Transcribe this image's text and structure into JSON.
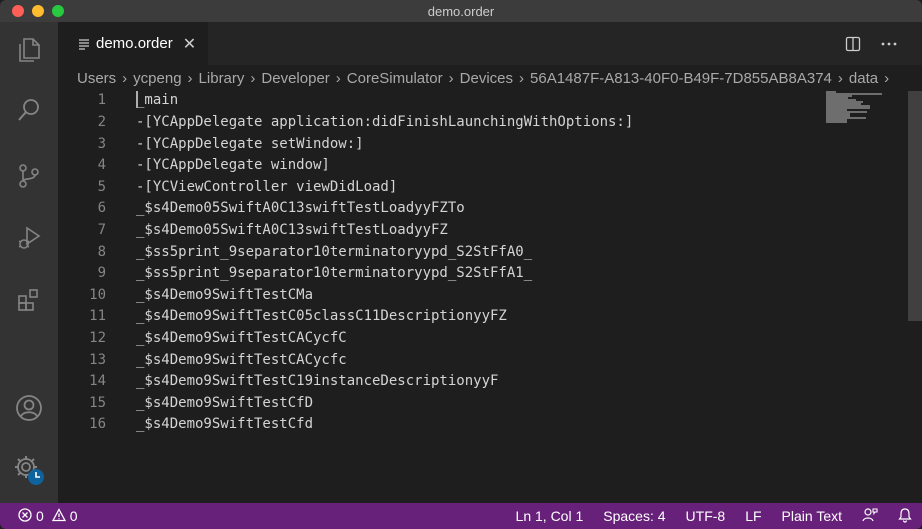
{
  "window": {
    "title": "demo.order"
  },
  "tab": {
    "label": "demo.order",
    "close": "✕"
  },
  "breadcrumb": [
    "Users",
    "ycpeng",
    "Library",
    "Developer",
    "CoreSimulator",
    "Devices",
    "56A1487F-A813-40F0-B49F-7D855AB8A374",
    "data"
  ],
  "editor": {
    "lines": [
      {
        "n": "1",
        "text": "_main"
      },
      {
        "n": "2",
        "text": "-[YCAppDelegate application:didFinishLaunchingWithOptions:]"
      },
      {
        "n": "3",
        "text": "-[YCAppDelegate setWindow:]"
      },
      {
        "n": "4",
        "text": "-[YCAppDelegate window]"
      },
      {
        "n": "5",
        "text": "-[YCViewController viewDidLoad]"
      },
      {
        "n": "6",
        "text": "_$s4Demo05SwiftA0C13swiftTestLoadyyFZTo"
      },
      {
        "n": "7",
        "text": "_$s4Demo05SwiftA0C13swiftTestLoadyyFZ"
      },
      {
        "n": "8",
        "text": "_$ss5print_9separator10terminatoryypd_S2StFfA0_"
      },
      {
        "n": "9",
        "text": "_$ss5print_9separator10terminatoryypd_S2StFfA1_"
      },
      {
        "n": "10",
        "text": "_$s4Demo9SwiftTestCMa"
      },
      {
        "n": "11",
        "text": "_$s4Demo9SwiftTestC05classC11DescriptionyyFZ"
      },
      {
        "n": "12",
        "text": "_$s4Demo9SwiftTestCACycfC"
      },
      {
        "n": "13",
        "text": "_$s4Demo9SwiftTestCACycfc"
      },
      {
        "n": "14",
        "text": "_$s4Demo9SwiftTestC19instanceDescriptionyyF"
      },
      {
        "n": "15",
        "text": "_$s4Demo9SwiftTestCfD"
      },
      {
        "n": "16",
        "text": "_$s4Demo9SwiftTestCfd"
      }
    ]
  },
  "status": {
    "errors": "0",
    "warnings": "0",
    "position": "Ln 1, Col 1",
    "spaces": "Spaces: 4",
    "encoding": "UTF-8",
    "eol": "LF",
    "language": "Plain Text"
  },
  "colors": {
    "statusbar": "#68217a",
    "activitybar": "#333333",
    "editor": "#1e1e1e"
  }
}
